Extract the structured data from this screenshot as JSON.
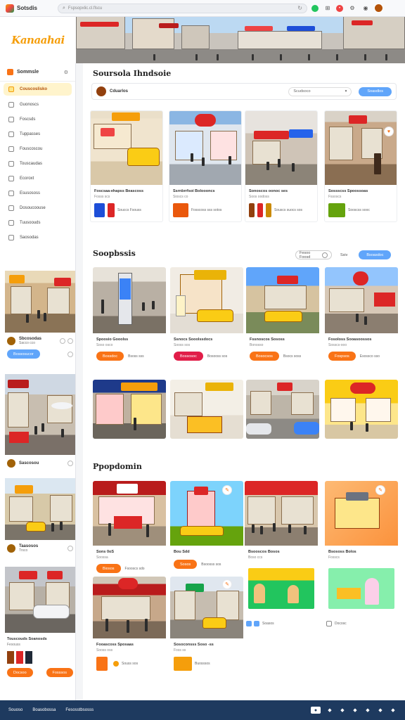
{
  "browser": {
    "brand": "Sotsdis",
    "address": "Fspsopxlic.cl.flscu",
    "icons": [
      "reload-icon",
      "extension-icon",
      "grid-icon",
      "notification-icon",
      "profile-icon"
    ]
  },
  "logo": {
    "main": "Kanaahai",
    "accent": "ai"
  },
  "sidebar": {
    "title": "Sommsle",
    "items": [
      {
        "label": "Couscoslisko",
        "active": true
      },
      {
        "label": "Guonoscs"
      },
      {
        "label": "Foscsds"
      },
      {
        "label": "Tuppasses"
      },
      {
        "label": "Fouscoscou"
      },
      {
        "label": "Touscaudas"
      },
      {
        "label": "Ecoroxt"
      },
      {
        "label": "Esusososs"
      },
      {
        "label": "Dosoucoouse"
      },
      {
        "label": "Tuusoouds"
      },
      {
        "label": "Saosodas"
      }
    ],
    "cards": [
      {
        "name": "Sbcosodas",
        "sub": "Sacco cco",
        "button": "Bossosucor"
      },
      {
        "name": "Sascosou",
        "sub": ""
      },
      {
        "name": "Taasosos",
        "sub": "Trsco"
      },
      {
        "name": "Touscouds Soanosds",
        "sub": "Fesouss",
        "button": "Docsoo",
        "button2": "Fosssos"
      }
    ]
  },
  "main": {
    "title": "Soursola Ihndsoie",
    "filter": {
      "name": "Cduarlos",
      "select": "Scudsoco",
      "button": "Soasdlos"
    },
    "row1": [
      {
        "title": "Foscsaa-ehapss Beascoss",
        "sub": "Fosss scs",
        "meta": "Souccs Fsouss"
      },
      {
        "title": "Ssrnbrrfsoi Boloooncs",
        "sub": "Sioscs co",
        "meta": "Fosscoss sss sotos"
      },
      {
        "title": "Sonoscos oonoc ses",
        "sub": "Soos oodoss",
        "meta": "Souscs suocs sos"
      },
      {
        "title": "Sossscss Spoossoas",
        "sub": "Fssoscs",
        "meta": "Sooscss sooc"
      }
    ],
    "section2": {
      "title": "Soopbssis",
      "sort": "Fesoo Foosd",
      "tabs": "Ssiv",
      "button": "Bsoasdoc"
    },
    "row2": [
      {
        "title": "Spoosio Gooolss",
        "sub": "Soso osco",
        "button": "Bossdoc",
        "meta": "Bsoss sss"
      },
      {
        "title": "Ssnocs Sooolssdocs",
        "sub": "Sooss sos",
        "button": "Bossosoc",
        "meta": "Bosooss sos"
      },
      {
        "title": "Fssnoscos Sososs",
        "sub": "Bonosso",
        "button": "Bosocsos",
        "meta": "Bsocs soss"
      },
      {
        "title": "Fosoloss Sooasoossos",
        "sub": "Sosscs-ooo",
        "button": "Fospsos",
        "meta": "Esossco sso"
      }
    ],
    "section3": {
      "title": "Ppopdomin"
    },
    "row3": [
      {
        "title": "Sons 0oS",
        "sub": "Soossa",
        "button": "Biosos",
        "meta": "Fsooscs sdo"
      },
      {
        "title": "Bou Sdd",
        "sub": "",
        "button": "Sosos",
        "meta": "Bsoosss sos"
      },
      {
        "title": "Bsooscos Bosos",
        "sub": "Boso ccs",
        "meta": ""
      },
      {
        "title": "Bsososs Bolos",
        "sub": "Fosscs",
        "meta": ""
      }
    ],
    "row4": [
      {
        "title": "Fooascoss Sposaas",
        "sub": "Sooss oss",
        "meta": "Souss sos"
      },
      {
        "title": "Sosoconsss Soso -ss",
        "sub": "Foss ss",
        "meta": "Buosssos"
      },
      {
        "title": "",
        "meta": "Soasos"
      },
      {
        "title": "",
        "meta": "Docosc"
      }
    ]
  },
  "footer": {
    "links": [
      "Souoso",
      "Boasobossa",
      "Fesosstbsosss"
    ]
  },
  "colors": {
    "accent": "#f97316",
    "blue": "#60a5fa",
    "navy": "#1e3a5f"
  }
}
